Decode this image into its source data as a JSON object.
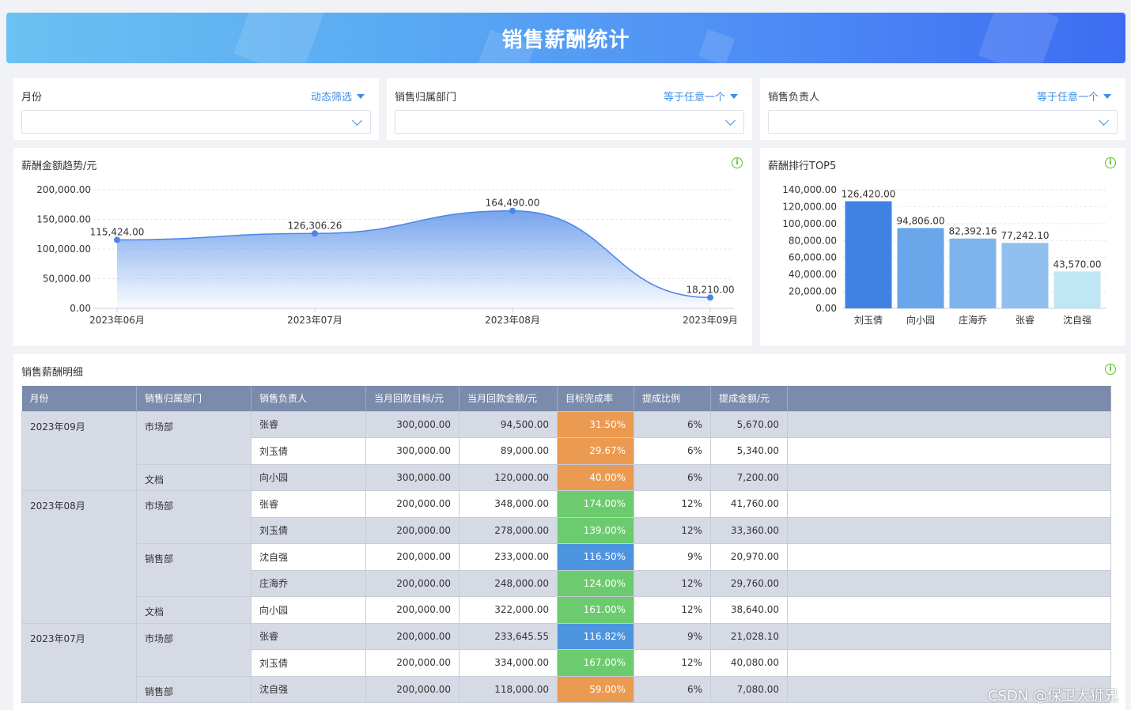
{
  "header": {
    "title": "销售薪酬统计"
  },
  "filters": [
    {
      "label": "月份",
      "mode": "动态筛选"
    },
    {
      "label": "销售归属部门",
      "mode": "等于任意一个"
    },
    {
      "label": "销售负责人",
      "mode": "等于任意一个"
    }
  ],
  "trend": {
    "title": "薪酬金额趋势/元"
  },
  "top5": {
    "title": "薪酬排行TOP5"
  },
  "detail": {
    "title": "销售薪酬明细",
    "columns": [
      "月份",
      "销售归属部门",
      "销售负责人",
      "当月回款目标/元",
      "当月回款金额/元",
      "目标完成率",
      "提成比例",
      "提成金额/元"
    ],
    "rows": [
      {
        "month": "2023年09月",
        "dept": "市场部",
        "person": "张睿",
        "target": "300,000.00",
        "amount": "94,500.00",
        "rate": "31.50%",
        "rate_color": "#eb9a51",
        "ratio": "6%",
        "commission": "5,670.00"
      },
      {
        "month": "",
        "dept": "",
        "person": "刘玉倩",
        "target": "300,000.00",
        "amount": "89,000.00",
        "rate": "29.67%",
        "rate_color": "#eb9a51",
        "ratio": "6%",
        "commission": "5,340.00"
      },
      {
        "month": "",
        "dept": "文档",
        "person": "向小园",
        "target": "300,000.00",
        "amount": "120,000.00",
        "rate": "40.00%",
        "rate_color": "#eb9a51",
        "ratio": "6%",
        "commission": "7,200.00"
      },
      {
        "month": "2023年08月",
        "dept": "市场部",
        "person": "张睿",
        "target": "200,000.00",
        "amount": "348,000.00",
        "rate": "174.00%",
        "rate_color": "#6ccb6e",
        "ratio": "12%",
        "commission": "41,760.00"
      },
      {
        "month": "",
        "dept": "",
        "person": "刘玉倩",
        "target": "200,000.00",
        "amount": "278,000.00",
        "rate": "139.00%",
        "rate_color": "#6ccb6e",
        "ratio": "12%",
        "commission": "33,360.00"
      },
      {
        "month": "",
        "dept": "销售部",
        "person": "沈自强",
        "target": "200,000.00",
        "amount": "233,000.00",
        "rate": "116.50%",
        "rate_color": "#4d94df",
        "ratio": "9%",
        "commission": "20,970.00"
      },
      {
        "month": "",
        "dept": "",
        "person": "庄海乔",
        "target": "200,000.00",
        "amount": "248,000.00",
        "rate": "124.00%",
        "rate_color": "#6ccb6e",
        "ratio": "12%",
        "commission": "29,760.00"
      },
      {
        "month": "",
        "dept": "文档",
        "person": "向小园",
        "target": "200,000.00",
        "amount": "322,000.00",
        "rate": "161.00%",
        "rate_color": "#6ccb6e",
        "ratio": "12%",
        "commission": "38,640.00"
      },
      {
        "month": "2023年07月",
        "dept": "市场部",
        "person": "张睿",
        "target": "200,000.00",
        "amount": "233,645.55",
        "rate": "116.82%",
        "rate_color": "#4d94df",
        "ratio": "9%",
        "commission": "21,028.10"
      },
      {
        "month": "",
        "dept": "",
        "person": "刘玉倩",
        "target": "200,000.00",
        "amount": "334,000.00",
        "rate": "167.00%",
        "rate_color": "#6ccb6e",
        "ratio": "12%",
        "commission": "40,080.00"
      },
      {
        "month": "",
        "dept": "销售部",
        "person": "沈自强",
        "target": "200,000.00",
        "amount": "118,000.00",
        "rate": "59.00%",
        "rate_color": "#eb9a51",
        "ratio": "6%",
        "commission": "7,080.00"
      }
    ]
  },
  "watermark": "CSDN @保卫大狮兄",
  "chart_data": [
    {
      "type": "area",
      "title": "薪酬金额趋势/元",
      "categories": [
        "2023年06月",
        "2023年07月",
        "2023年08月",
        "2023年09月"
      ],
      "series": [
        {
          "values": [
            115424.0,
            126306.26,
            164490.0,
            18210.0
          ]
        }
      ],
      "value_labels": [
        "115,424.00",
        "126,306.26",
        "164,490.00",
        "18,210.00"
      ],
      "y_ticks": [
        "0.00",
        "50,000.00",
        "100,000.00",
        "150,000.00",
        "200,000.00"
      ],
      "ylim": [
        0,
        200000
      ],
      "grid": true,
      "color": "#4a86e8"
    },
    {
      "type": "bar",
      "title": "薪酬排行TOP5",
      "categories": [
        "刘玉倩",
        "向小园",
        "庄海乔",
        "张睿",
        "沈自强"
      ],
      "values": [
        126420.0,
        94806.0,
        82392.16,
        77242.1,
        43570.0
      ],
      "value_labels": [
        "126,420.00",
        "94,806.00",
        "82,392.16",
        "77,242.10",
        "43,570.00"
      ],
      "y_ticks": [
        "0.00",
        "20,000.00",
        "40,000.00",
        "60,000.00",
        "80,000.00",
        "100,000.00",
        "120,000.00",
        "140,000.00"
      ],
      "ylim": [
        0,
        140000
      ],
      "grid": true,
      "colors": [
        "#3f82e3",
        "#6aa6ea",
        "#7db4ec",
        "#90c0ee",
        "#bfe6f4"
      ]
    }
  ]
}
